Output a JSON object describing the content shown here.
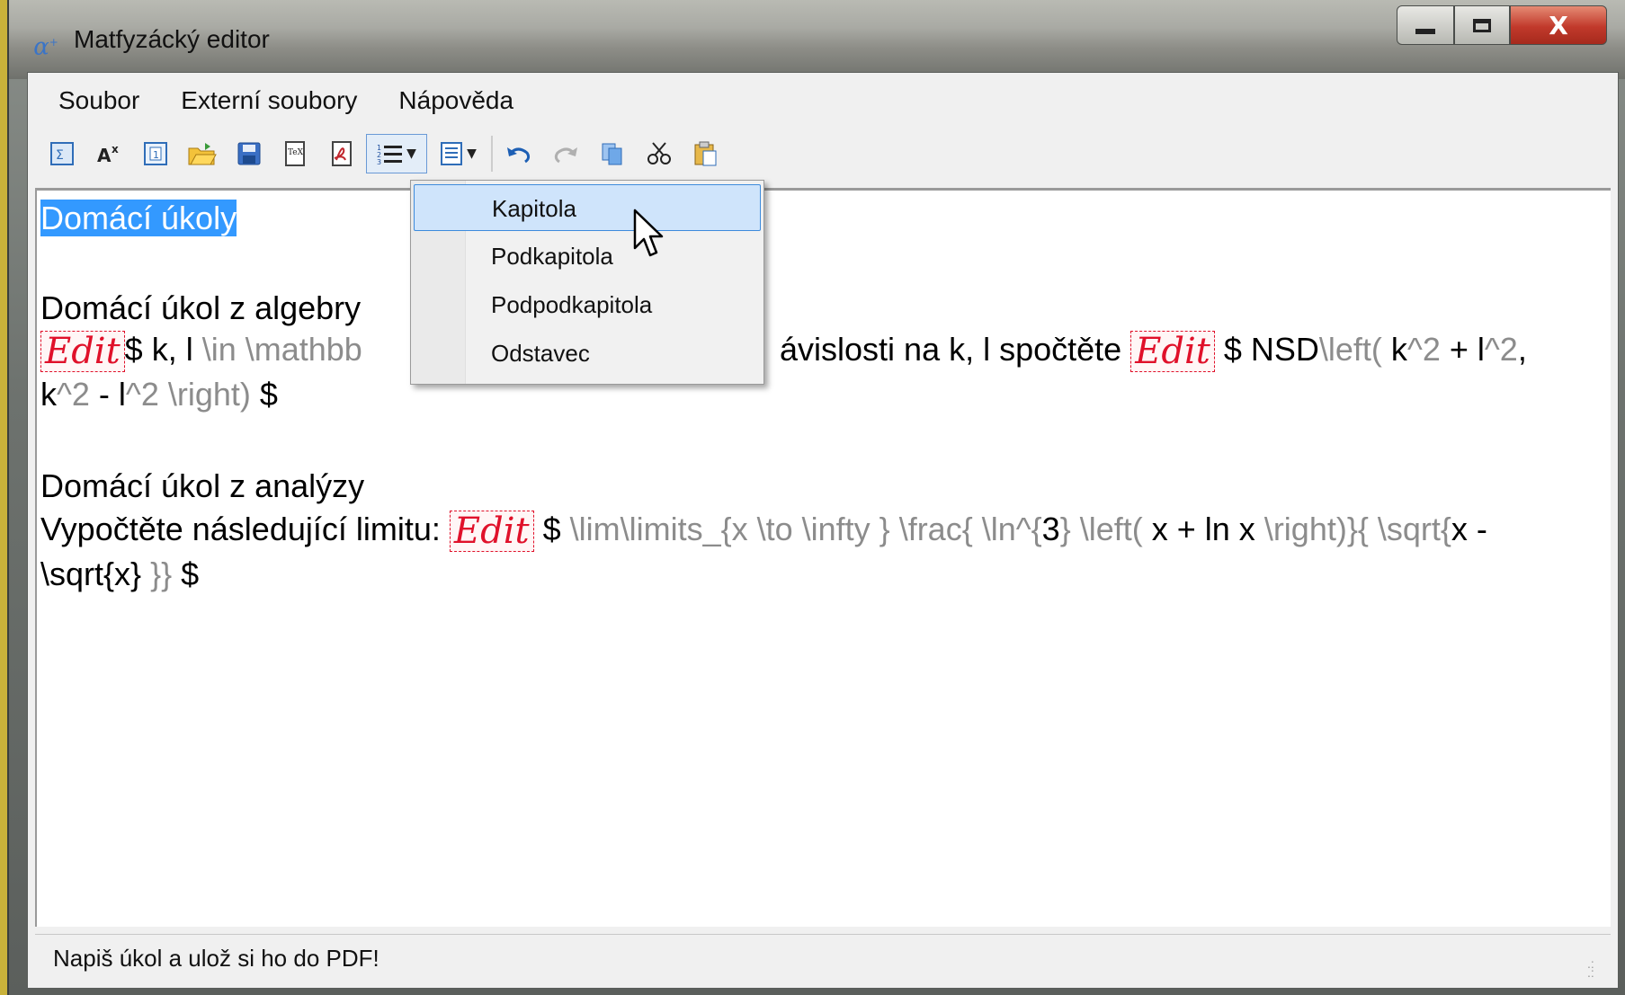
{
  "window": {
    "title": "Matfyzácký editor",
    "icon_glyph": "α",
    "close_glyph": "X"
  },
  "menubar": {
    "items": [
      "Soubor",
      "Externí soubory",
      "Nápověda"
    ]
  },
  "toolbar": {
    "buttons": [
      {
        "icon": "insert-formula-icon"
      },
      {
        "icon": "superscript-icon"
      },
      {
        "icon": "info-box-icon"
      },
      {
        "icon": "open-folder-icon"
      },
      {
        "icon": "save-icon"
      },
      {
        "icon": "tex-export-icon"
      },
      {
        "icon": "pdf-export-icon"
      },
      {
        "icon": "numbered-list-icon",
        "dropdown": true,
        "pressed": true
      },
      {
        "icon": "document-style-icon",
        "dropdown": true
      },
      {
        "icon": "undo-icon"
      },
      {
        "icon": "redo-icon"
      },
      {
        "icon": "copy-icon"
      },
      {
        "icon": "cut-icon"
      },
      {
        "icon": "paste-icon"
      }
    ]
  },
  "dropdown": {
    "items": [
      "Kapitola",
      "Podkapitola",
      "Podpodkapitola",
      "Odstavec"
    ],
    "hovered": "Kapitola"
  },
  "editor": {
    "title_selected": "Domácí úkoly",
    "h_algebra": "Domácí úkol z algebry",
    "algebra_line1": {
      "edit": "Edit",
      "t1": "$ k, l ",
      "m1": "\\in  \\mathbb",
      "t2": "ávislosti na k, l spočtěte ",
      "edit2": "Edit",
      "t3": " $ NSD",
      "m2": "\\left(",
      "t4": " k",
      "m3": "^2",
      "t5": " + l",
      "m4": "^2",
      "t6": ","
    },
    "algebra_line2": {
      "t1": "k",
      "m1": "^2",
      "t2": " - l",
      "m2": "^2 \\right)",
      "t3": " $"
    },
    "h_analysis": "Domácí úkol z analýzy",
    "analysis_line1": {
      "t1": "Vypočtěte následující limitu: ",
      "edit": "Edit",
      "t2": " $ ",
      "m1": "\\lim\\limits_{x \\to  \\infty } \\frac{ \\ln^{",
      "t3": "3",
      "m2": "} \\left(",
      "t4": " x + ln x ",
      "m3": " \\right)}{ \\sqrt{",
      "t5": "x -"
    },
    "analysis_line2": {
      "t1": "\\sqrt{x}",
      "m1": " }}",
      "t2": " $"
    }
  },
  "statusbar": {
    "text": "Napiš úkol a ulož si ho do PDF!"
  },
  "colors": {
    "accent": "#3399ff",
    "edit_badge": "#e0112a",
    "latex_muted": "#8c8c8c"
  }
}
